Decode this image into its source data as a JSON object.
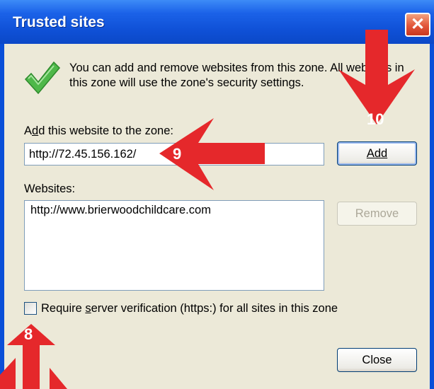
{
  "window": {
    "title": "Trusted sites",
    "close_glyph": "✕"
  },
  "info": {
    "text": "You can add and remove websites from this zone. All websites in this zone will use the zone's security settings."
  },
  "add_section": {
    "label_pre": "A",
    "label_accel": "d",
    "label_post": "d this website to the zone:",
    "input_value": "http://72.45.156.162/",
    "add_button": "Add"
  },
  "websites": {
    "label": "Websites:",
    "items": [
      "http://www.brierwoodchildcare.com"
    ],
    "remove_button": "Remove"
  },
  "checkbox": {
    "label_pre": "Require ",
    "label_accel": "s",
    "label_post": "erver verification (https:) for all sites in this zone",
    "checked": false
  },
  "footer": {
    "close_button": "Close"
  },
  "annotations": {
    "arrow_8": "8",
    "arrow_9": "9",
    "arrow_10": "10",
    "color": "#e5282b"
  },
  "icons": [
    "checkmark-icon",
    "close-icon"
  ]
}
